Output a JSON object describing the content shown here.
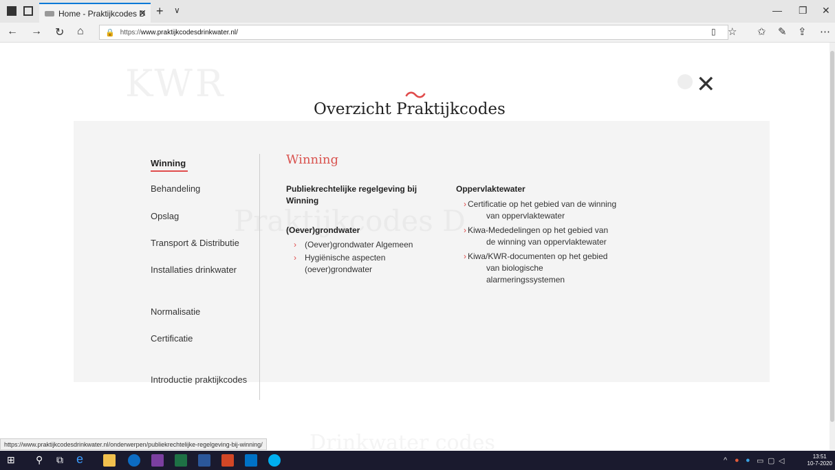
{
  "browser": {
    "tab_title": "Home - Praktijkcodes D",
    "tab_close": "✕",
    "new_tab": "+",
    "tab_menu": "∨",
    "url_prefix": "https://",
    "url_host": "www.praktijkcodesdrinkwater.nl/",
    "status_url": "https://www.praktijkcodesdrinkwater.nl/onderwerpen/publiekrechtelijke-regelgeving-bij-winning/"
  },
  "overlay": {
    "tilde": "〜",
    "title": "Overzicht Praktijkcodes",
    "close": "✕"
  },
  "ghost": {
    "logo": "KWR",
    "title": "Praktijkcodes D...",
    "bottom": "Drinkwater codes"
  },
  "nav": {
    "items": [
      {
        "label": "Winning"
      },
      {
        "label": "Behandeling"
      },
      {
        "label": "Opslag"
      },
      {
        "label": "Transport & Distributie"
      },
      {
        "label": "Installaties drinkwater"
      },
      {
        "label": "Normalisatie"
      },
      {
        "label": "Certificatie"
      },
      {
        "label": "Introductie praktijkcodes"
      }
    ]
  },
  "content": {
    "section_title": "Winning",
    "chevron": "›",
    "col1": {
      "head1": "Publiekrechtelijke regelgeving bij Winning",
      "head2": "(Oever)grondwater",
      "links": [
        "(Oever)grondwater Algemeen",
        "Hygiënische aspecten (oever)grondwater"
      ]
    },
    "col2": {
      "head": "Oppervlaktewater",
      "links": [
        "Certificatie op het gebied van de winning van oppervlaktewater",
        "Kiwa-Mededelingen op het gebied van de winning van oppervlaktewater",
        "Kiwa/KWR-documenten op het gebied van biologische alarmeringssystemen"
      ]
    }
  },
  "taskbar": {
    "time": "13:51",
    "date": "10-7-2020"
  }
}
